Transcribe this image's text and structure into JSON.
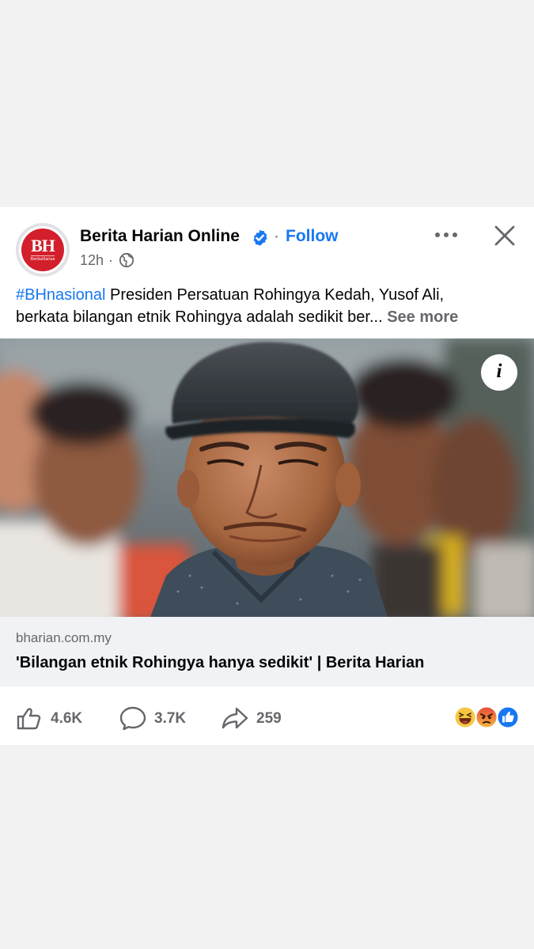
{
  "post": {
    "page_name": "Berita Harian Online",
    "follow_label": "Follow",
    "time": "12h",
    "time_separator": "·",
    "logo": {
      "mark": "BH",
      "sub": "BeritaHarian"
    },
    "caption": {
      "hashtag": "#BHnasional",
      "line1_rest": " Presiden Persatuan Rohingya Kedah, Yusof Ali,",
      "line2": "berkata bilangan etnik Rohingya adalah sedikit ber...",
      "see_more": "See more"
    },
    "info_glyph": "i",
    "link": {
      "domain": "bharian.com.my",
      "title": "'Bilangan etnik Rohingya hanya sedikit' | Berita Harian"
    },
    "counts": {
      "likes": "4.6K",
      "comments": "3.7K",
      "shares": "259"
    },
    "icons": [
      "verified-badge-icon",
      "globe-icon",
      "more-options-icon",
      "close-icon",
      "info-icon",
      "like-icon",
      "comment-icon",
      "share-icon",
      "haha-reaction-icon",
      "angry-reaction-icon",
      "like-reaction-icon"
    ],
    "colors": {
      "accent": "#1877f2",
      "brand_red": "#d21f2b",
      "muted": "#65676b",
      "link_bg": "#f0f2f5"
    }
  }
}
